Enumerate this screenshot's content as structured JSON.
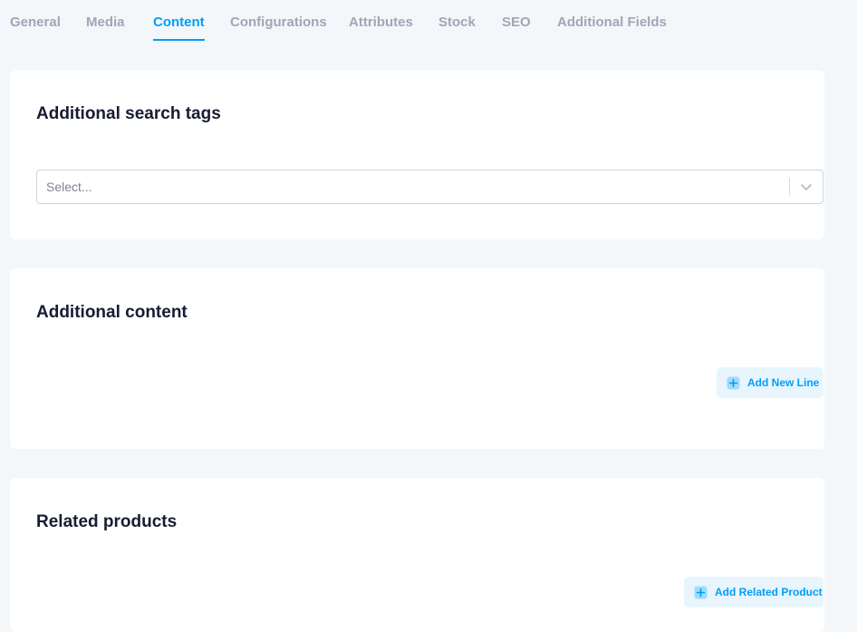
{
  "tabs": [
    {
      "label": "General"
    },
    {
      "label": "Media"
    },
    {
      "label": "Content"
    },
    {
      "label": "Configurations"
    },
    {
      "label": "Attributes"
    },
    {
      "label": "Stock"
    },
    {
      "label": "SEO"
    },
    {
      "label": "Additional Fields"
    }
  ],
  "active_tab": "Content",
  "search_tags": {
    "title": "Additional search tags",
    "select_placeholder": "Select...",
    "chevron_icon": "chevron-down-icon"
  },
  "additional_content": {
    "title": "Additional content",
    "add_button_label": "Add New Line",
    "add_icon": "plus-square-icon"
  },
  "related_products": {
    "title": "Related products",
    "add_button_label": "Add Related Product",
    "add_icon": "plus-square-icon"
  },
  "colors": {
    "accent": "#009ef7",
    "tab_inactive": "#a1a5b7",
    "background": "#f4f7f9",
    "button_bg": "#e8f5fd"
  }
}
